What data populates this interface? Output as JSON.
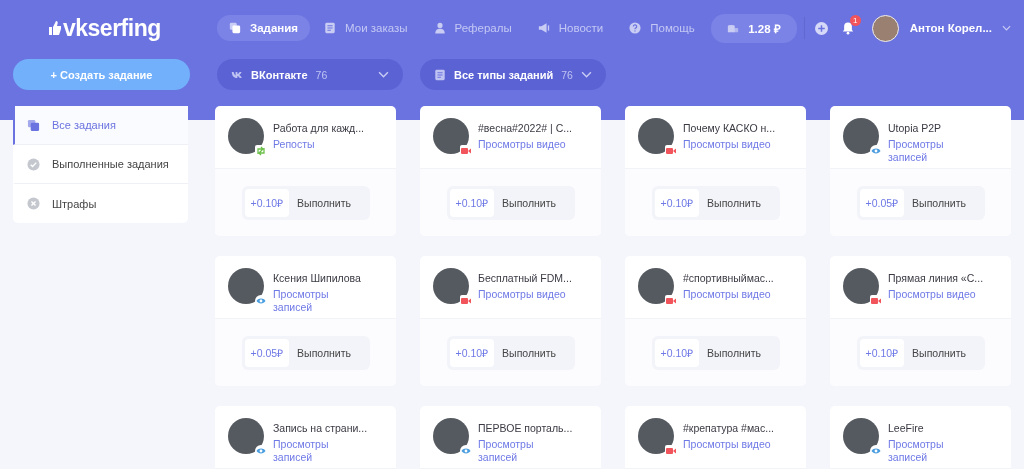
{
  "logo": {
    "text": "vkserfing"
  },
  "nav": [
    {
      "label": "Задания",
      "selected": true
    },
    {
      "label": "Мои заказы",
      "selected": false
    },
    {
      "label": "Рефералы",
      "selected": false
    },
    {
      "label": "Новости",
      "selected": false
    },
    {
      "label": "Помощь",
      "selected": false
    }
  ],
  "balance": "1.28 ₽",
  "notifications": {
    "count": "1"
  },
  "user": {
    "name": "Антон Корел..."
  },
  "create_button": "+ Создать задание",
  "filters": [
    {
      "label": "ВКонтакте",
      "count": "76"
    },
    {
      "label": "Все типы заданий",
      "count": "76"
    }
  ],
  "sidebar": {
    "items": [
      {
        "label": "Все задания",
        "selected": true
      },
      {
        "label": "Выполненные задания",
        "selected": false
      },
      {
        "label": "Штрафы",
        "selected": false
      }
    ]
  },
  "tasks": [
    {
      "title": "Работа для кажд...",
      "type": "Репосты",
      "kind": "repost",
      "reward": "+0.10₽",
      "action": "Выполнить"
    },
    {
      "title": "#весна#2022# | С...",
      "type": "Просмотры видео",
      "kind": "video",
      "reward": "+0.10₽",
      "action": "Выполнить"
    },
    {
      "title": "Почему КАСКО н...",
      "type": "Просмотры видео",
      "kind": "video",
      "reward": "+0.10₽",
      "action": "Выполнить"
    },
    {
      "title": "Utopia P2P",
      "type": "Просмотры записей",
      "kind": "views",
      "reward": "+0.05₽",
      "action": "Выполнить"
    },
    {
      "title": "Ксения Шипилова",
      "type": "Просмотры записей",
      "kind": "views",
      "reward": "+0.05₽",
      "action": "Выполнить"
    },
    {
      "title": "Бесплатный FDM...",
      "type": "Просмотры видео",
      "kind": "video",
      "reward": "+0.10₽",
      "action": "Выполнить"
    },
    {
      "title": "#спортивныймас...",
      "type": "Просмотры видео",
      "kind": "video",
      "reward": "+0.10₽",
      "action": "Выполнить"
    },
    {
      "title": "Прямая линия «С...",
      "type": "Просмотры видео",
      "kind": "video",
      "reward": "+0.10₽",
      "action": "Выполнить"
    },
    {
      "title": "Запись на страни...",
      "type": "Просмотры записей",
      "kind": "views"
    },
    {
      "title": "ПЕРВОЕ порталь...",
      "type": "Просмотры записей",
      "kind": "views"
    },
    {
      "title": "#крепатура #мас...",
      "type": "Просмотры видео",
      "kind": "video"
    },
    {
      "title": "LeeFire",
      "type": "Просмотры записей",
      "kind": "views"
    }
  ]
}
